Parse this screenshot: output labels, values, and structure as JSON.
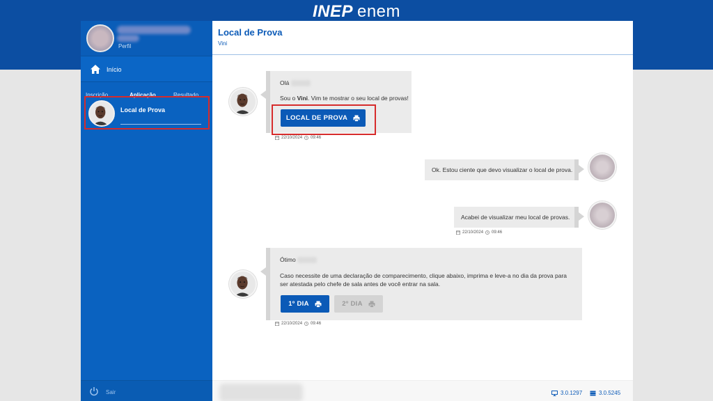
{
  "header": {
    "brand_inep": "INEP",
    "brand_enem": "enem"
  },
  "sidebar": {
    "profile_label": "Perfil",
    "home_label": "Início",
    "tabs": [
      "Inscrição",
      "Aplicação",
      "Resultado"
    ],
    "active_item": "Local de Prova",
    "logout_label": "Sair"
  },
  "main": {
    "title": "Local de Prova",
    "subtitle": "Vini"
  },
  "chat": {
    "msg1": {
      "greeting": "Olá",
      "text_prefix": "Sou o ",
      "text_name": "Vini",
      "text_suffix": ". Vim te mostrar o seu local de provas!",
      "button_label": "LOCAL DE PROVA",
      "date": "22/10/2024",
      "time": "09:46"
    },
    "msg2": {
      "text": "Ok. Estou ciente que devo visualizar o local de prova."
    },
    "msg3": {
      "text": "Acabei de visualizar meu local de provas.",
      "date": "22/10/2024",
      "time": "09:46"
    },
    "msg4": {
      "greeting": "Ótimo",
      "text": "Caso necessite de uma declaração de comparecimento, clique abaixo, imprima e leve-a no dia da prova para ser atestada pelo chefe de sala antes de você entrar na sala.",
      "button1_label": "1º DIA",
      "button2_label": "2º DIA",
      "date": "22/10/2024",
      "time": "09:46"
    }
  },
  "footer": {
    "version_front": "3.0.1297",
    "version_back": "3.0.5245"
  },
  "colors": {
    "brand_blue": "#0c4ea2",
    "sidebar_blue": "#0a62c0",
    "button_blue": "#0b5ab7",
    "highlight_red": "#d62b2b"
  }
}
